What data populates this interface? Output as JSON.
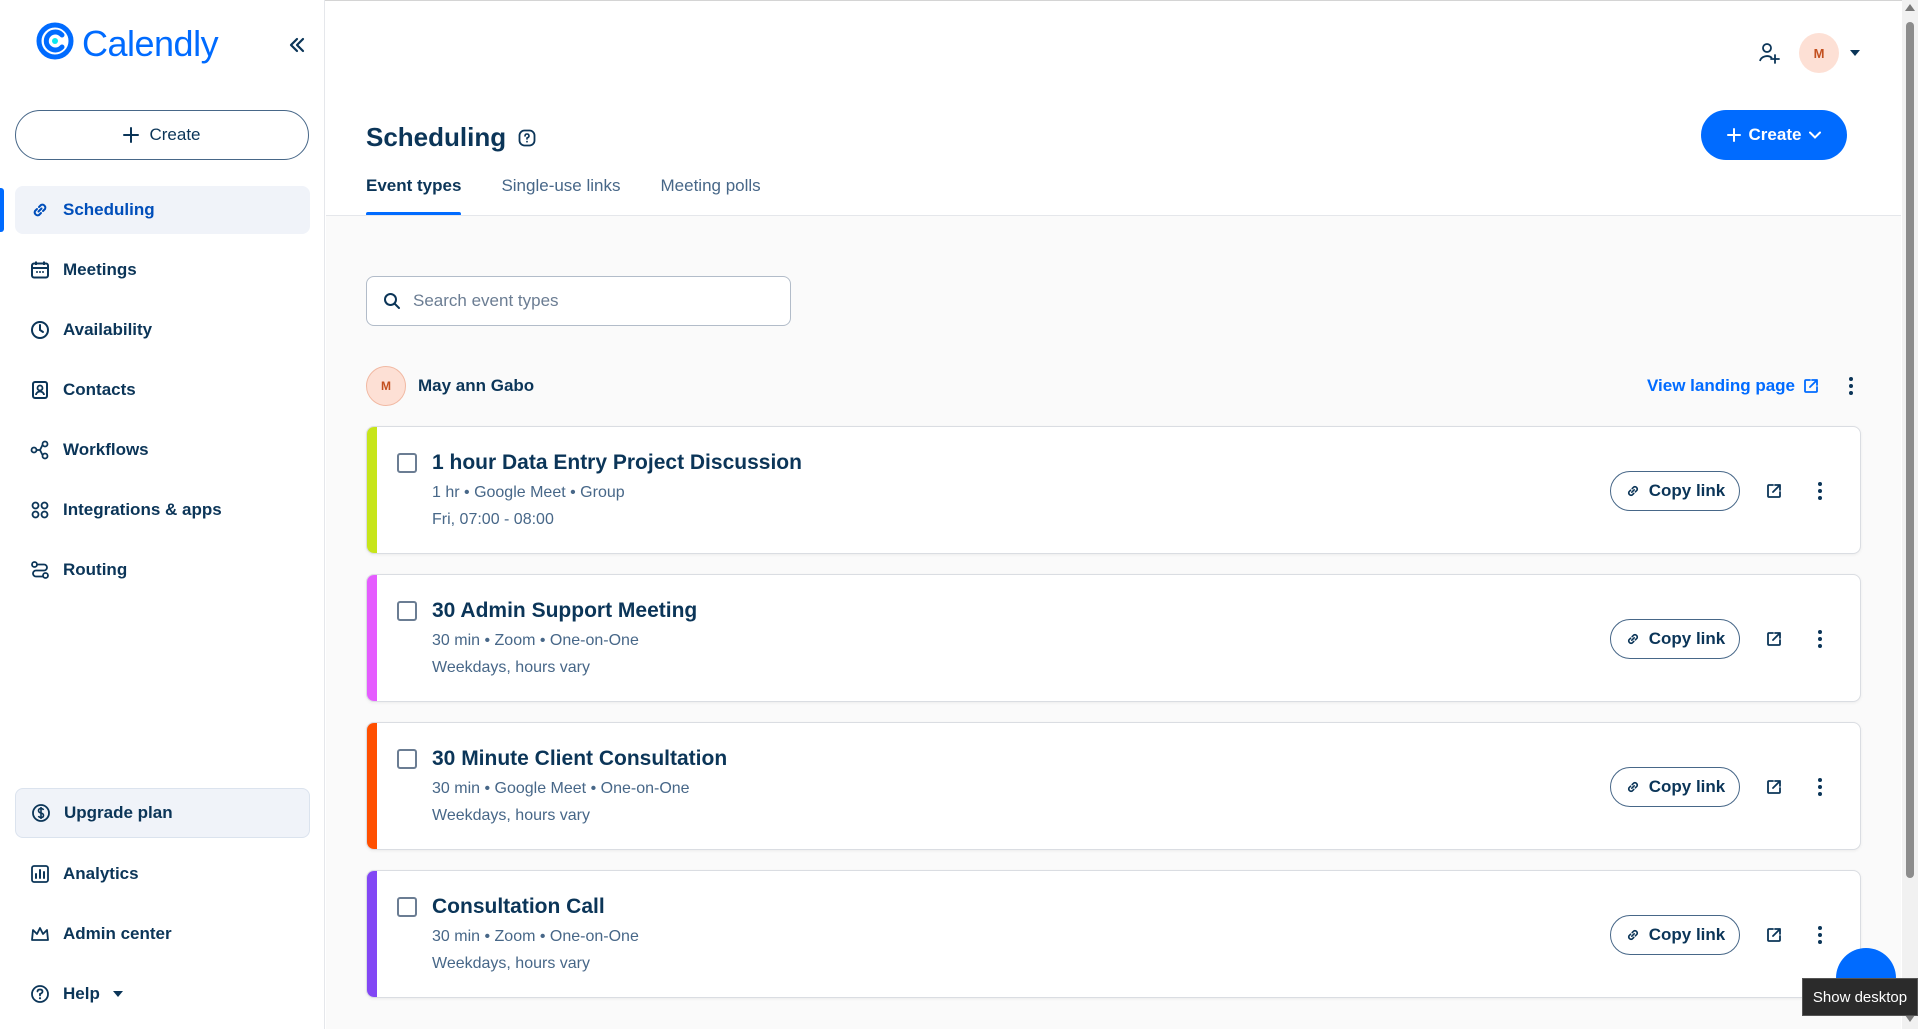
{
  "app": {
    "logo_text": "Calendly",
    "brand_color": "#006bff",
    "collapse_icon": "double-chevron-left-icon"
  },
  "sidebar": {
    "create_label": "Create",
    "items": [
      {
        "label": "Scheduling",
        "icon": "link-icon",
        "active": true
      },
      {
        "label": "Meetings",
        "icon": "calendar-icon",
        "active": false
      },
      {
        "label": "Availability",
        "icon": "clock-icon",
        "active": false
      },
      {
        "label": "Contacts",
        "icon": "contact-book-icon",
        "active": false
      },
      {
        "label": "Workflows",
        "icon": "workflow-icon",
        "active": false
      },
      {
        "label": "Integrations & apps",
        "icon": "grid-icon",
        "active": false
      },
      {
        "label": "Routing",
        "icon": "routing-icon",
        "active": false
      }
    ],
    "bottom": {
      "upgrade_label": "Upgrade plan",
      "analytics_label": "Analytics",
      "admin_label": "Admin center",
      "help_label": "Help"
    }
  },
  "header": {
    "avatar_initial": "M",
    "title": "Scheduling",
    "create_label": "Create"
  },
  "tabs": [
    {
      "label": "Event types",
      "active": true
    },
    {
      "label": "Single-use links",
      "active": false
    },
    {
      "label": "Meeting polls",
      "active": false
    }
  ],
  "search": {
    "placeholder": "Search event types",
    "value": ""
  },
  "owner": {
    "initial": "M",
    "name": "May ann Gabo",
    "landing_label": "View landing page"
  },
  "event_types": [
    {
      "title": "1 hour Data Entry Project Discussion",
      "meta": "1 hr • Google Meet • Group",
      "schedule": "Fri, 07:00 - 08:00",
      "color": "#c7e51a",
      "copy_label": "Copy link"
    },
    {
      "title": "30 Admin Support Meeting",
      "meta": "30 min • Zoom • One-on-One",
      "schedule": "Weekdays, hours vary",
      "color": "#e55cff",
      "copy_label": "Copy link"
    },
    {
      "title": "30 Minute Client Consultation",
      "meta": "30 min • Google Meet • One-on-One",
      "schedule": "Weekdays, hours vary",
      "color": "#ff4f00",
      "copy_label": "Copy link"
    },
    {
      "title": "Consultation Call",
      "meta": "30 min • Zoom • One-on-One",
      "schedule": "Weekdays, hours vary",
      "color": "#8247f5",
      "copy_label": "Copy link"
    }
  ],
  "tooltip": {
    "text": "Show desktop"
  }
}
